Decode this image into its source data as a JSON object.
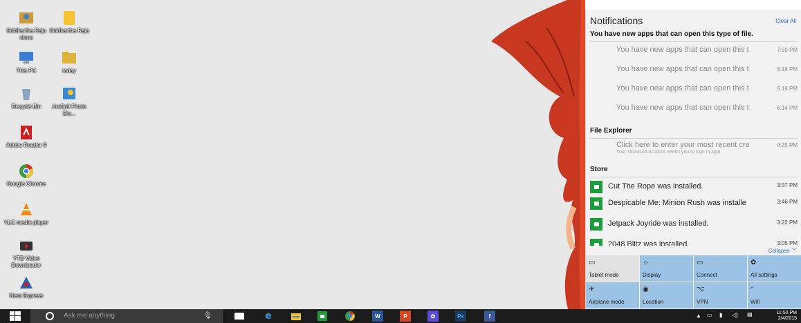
{
  "desktop": {
    "icons": [
      {
        "label": "Siddhartha Raju clone",
        "icon": "user-folder-icon",
        "color": "#c89a3c"
      },
      {
        "label": "Siddhartha Raju",
        "icon": "folder-icon",
        "color": "#f4c431"
      },
      {
        "label": "This PC",
        "icon": "computer-icon",
        "color": "#3a7fd5"
      },
      {
        "label": "today",
        "icon": "folder-icon",
        "color": "#e0b43a"
      },
      {
        "label": "Recycle Bin",
        "icon": "recycle-bin-icon",
        "color": "#8aa4c4"
      },
      {
        "label": "ArcSoft Photo Stu...",
        "icon": "photo-app-icon",
        "color": "#3b8ad8"
      },
      {
        "label": "Adobe Reader 9",
        "icon": "pdf-icon",
        "color": "#c9201f"
      },
      {
        "label": "Google Chrome",
        "icon": "chrome-icon",
        "color": "#3b9c3f"
      },
      {
        "label": "VLC media player",
        "icon": "vlc-icon",
        "color": "#f08a10"
      },
      {
        "label": "YTD Video Downloader",
        "icon": "ytd-icon",
        "color": "#c71f1f"
      },
      {
        "label": "Nero Express",
        "icon": "nero-icon",
        "color": "#2a5fa8"
      }
    ]
  },
  "action_center": {
    "title": "Notifications",
    "clear_all": "Clear All",
    "group1": {
      "title": "You have new apps that can open this type of file.",
      "items": [
        {
          "text": "You have new apps that can open this t",
          "time": "7:59 PM"
        },
        {
          "text": "You have new apps that can open this t",
          "time": "6:18 PM"
        },
        {
          "text": "You have new apps that can open this t",
          "time": "6:18 PM"
        },
        {
          "text": "You have new apps that can open this t",
          "time": "6:14 PM"
        }
      ]
    },
    "file_explorer": {
      "title": "File Explorer",
      "text": "Click here to enter your most recent cre",
      "subtext": "Your Microsoft account needs you to sign in agai",
      "time": "4:25 PM"
    },
    "store": {
      "title": "Store",
      "items": [
        {
          "text": "Cut The Rope was installed.",
          "time": "3:57 PM"
        },
        {
          "text": "Despicable Me: Minion Rush was installe",
          "time": "3:46 PM"
        },
        {
          "text": "Jetpack Joyride was installed.",
          "time": "3:22 PM"
        },
        {
          "text": "2048 Blitz was installed.",
          "time": "3:05 PM"
        }
      ]
    },
    "collapse": "Collapse",
    "quick_actions": [
      {
        "label": "Tablet mode",
        "icon": "tablet-mode-icon",
        "glyph": "▭",
        "state": "off"
      },
      {
        "label": "Display",
        "icon": "display-icon",
        "glyph": "☼",
        "state": "on"
      },
      {
        "label": "Connect",
        "icon": "connect-icon",
        "glyph": "▭",
        "state": "on"
      },
      {
        "label": "All settings",
        "icon": "settings-icon",
        "glyph": "✿",
        "state": "on"
      },
      {
        "label": "Airplane mode",
        "icon": "airplane-icon",
        "glyph": "✈",
        "state": "on"
      },
      {
        "label": "Location",
        "icon": "location-icon",
        "glyph": "◉",
        "state": "on"
      },
      {
        "label": "VPN",
        "icon": "vpn-icon",
        "glyph": "⌥",
        "state": "on"
      },
      {
        "label": "Wifi",
        "icon": "wifi-icon",
        "glyph": "◜",
        "state": "on"
      }
    ]
  },
  "taskbar": {
    "search_placeholder": "Ask me anything",
    "apps": [
      {
        "name": "task-view",
        "color": "#ffffff",
        "glyph": "▭"
      },
      {
        "name": "edge",
        "color": "#3a96dd",
        "glyph": "e"
      },
      {
        "name": "file-explorer",
        "color": "#f4c431",
        "glyph": "▬"
      },
      {
        "name": "store",
        "color": "#1f9c3c",
        "glyph": "▪"
      },
      {
        "name": "chrome",
        "color": "#e8a020",
        "glyph": "●"
      },
      {
        "name": "word",
        "color": "#2b5797",
        "glyph": "W"
      },
      {
        "name": "powerpoint",
        "color": "#d24726",
        "glyph": "P"
      },
      {
        "name": "settings",
        "color": "#5a4fd6",
        "glyph": "✿"
      },
      {
        "name": "photoshop",
        "color": "#1d3a58",
        "glyph": "Ps"
      },
      {
        "name": "facebook",
        "color": "#3b5998",
        "glyph": "f"
      }
    ],
    "clock_time": "11:50 PM",
    "clock_date": "2/4/2015"
  }
}
